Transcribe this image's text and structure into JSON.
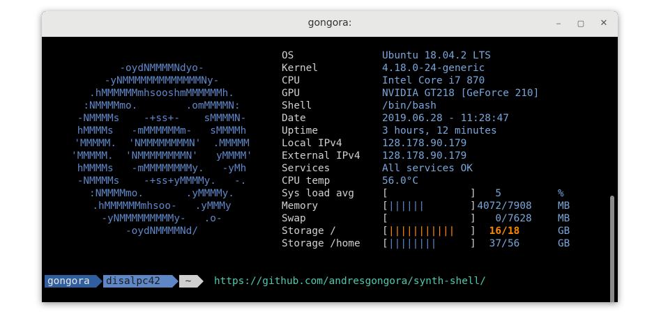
{
  "window": {
    "title": "gongora:",
    "minimize_glyph": "‒",
    "maximize_glyph": "▢",
    "close_glyph": "✕"
  },
  "logo": [
    "-oydNMMMMNdyo-",
    "-yNMMMMMMMMMMMMMNy-",
    ".hMMMMMMmhsooshmMMMMMMh.",
    ":NMMMMmo.        .omMMMMN:",
    "-NMMMMs    -+ss+-    sMMMMN-",
    "hMMMMs   -mMMMMMMm-   sMMMMh",
    "'MMMMM.  'NMMMMMMMMN'  .MMMMM",
    "'MMMMM.  'NMMMMMMMMN'   yMMMM'",
    "hMMMMs   -mMMMMMMMMy.   -yMh",
    "-NMMMMs    -+ss+yMMMMy.   -.",
    ":NMMMMmo.       .yMMMMy.",
    ".hMMMMMMmhsoo-   .yMMMy",
    "-yNMMMMMMMMMy-   .o-",
    "-oydNMMMMNd/"
  ],
  "info": [
    {
      "label": "OS",
      "value": "Ubuntu 18.04.2 LTS"
    },
    {
      "label": "Kernel",
      "value": "4.18.0-24-generic"
    },
    {
      "label": "CPU",
      "value": "Intel Core i7 870"
    },
    {
      "label": "GPU",
      "value": "NVIDIA GT218 [GeForce 210]"
    },
    {
      "label": "Shell",
      "value": "/bin/bash"
    },
    {
      "label": "Date",
      "value": "2019.06.28 - 11:28:47"
    },
    {
      "label": "Uptime",
      "value": "3 hours, 12 minutes"
    },
    {
      "label": "Local IPv4",
      "value": "128.178.90.179"
    },
    {
      "label": "External IPv4",
      "value": "128.178.90.179"
    },
    {
      "label": "Services",
      "value": "All services OK"
    },
    {
      "label": "CPU temp",
      "value": "56.0°C"
    }
  ],
  "gauges": [
    {
      "label": "Sys load avg",
      "bars": "",
      "bar_color": "blue",
      "used": "5",
      "sep": "",
      "total": "",
      "unit": "%"
    },
    {
      "label": "Memory",
      "bars": "||||||",
      "bar_color": "blue",
      "used": "4072",
      "sep": "/",
      "total": "7908",
      "unit": "MB"
    },
    {
      "label": "Swap",
      "bars": "",
      "bar_color": "blue",
      "used": "0",
      "sep": "/",
      "total": "7628",
      "unit": "MB"
    },
    {
      "label": "Storage /",
      "bars": "|||||||||||",
      "bar_color": "orange",
      "used": "16",
      "sep": "/",
      "total": "18",
      "unit": "GB"
    },
    {
      "label": "Storage /home",
      "bars": "||||||||",
      "bar_color": "blue",
      "used": "37",
      "sep": "/",
      "total": "56",
      "unit": "GB"
    }
  ],
  "prompt": {
    "user": "gongora",
    "host": "disalpc42",
    "dir": "~",
    "command": "https://github.com/andresgongora/synth-shell/"
  },
  "colors": {
    "logo": "#5f87c7",
    "value": "#7aa6da",
    "label": "#d0d0d0",
    "warning": "#ff8800",
    "prompt_user_bg": "#2f5f9e",
    "prompt_host_bg": "#5f87c7",
    "prompt_dir_bg": "#d0d0d0",
    "command": "#4ec9b0"
  }
}
